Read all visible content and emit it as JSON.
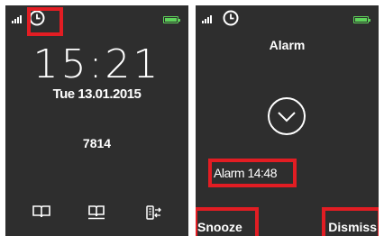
{
  "home_screen": {
    "time": "15:21",
    "date": "Tue 13.01.2015",
    "code": "7814",
    "icons": [
      "signal-icon",
      "alarm-clock-icon",
      "battery-icon",
      "book-icon",
      "phonebook-icon",
      "call-transfer-icon"
    ]
  },
  "alarm_screen": {
    "title": "Alarm",
    "alarm_label": "Alarm 14:48",
    "snooze_label": "Snooze",
    "dismiss_label": "Dismiss",
    "icons": [
      "signal-icon",
      "alarm-clock-icon",
      "battery-icon",
      "chevron-down-icon"
    ]
  },
  "colors": {
    "screen_bg": "#2e2e2e",
    "highlight": "#e21d23",
    "battery": "#5ed35a",
    "text": "#ffffff"
  }
}
